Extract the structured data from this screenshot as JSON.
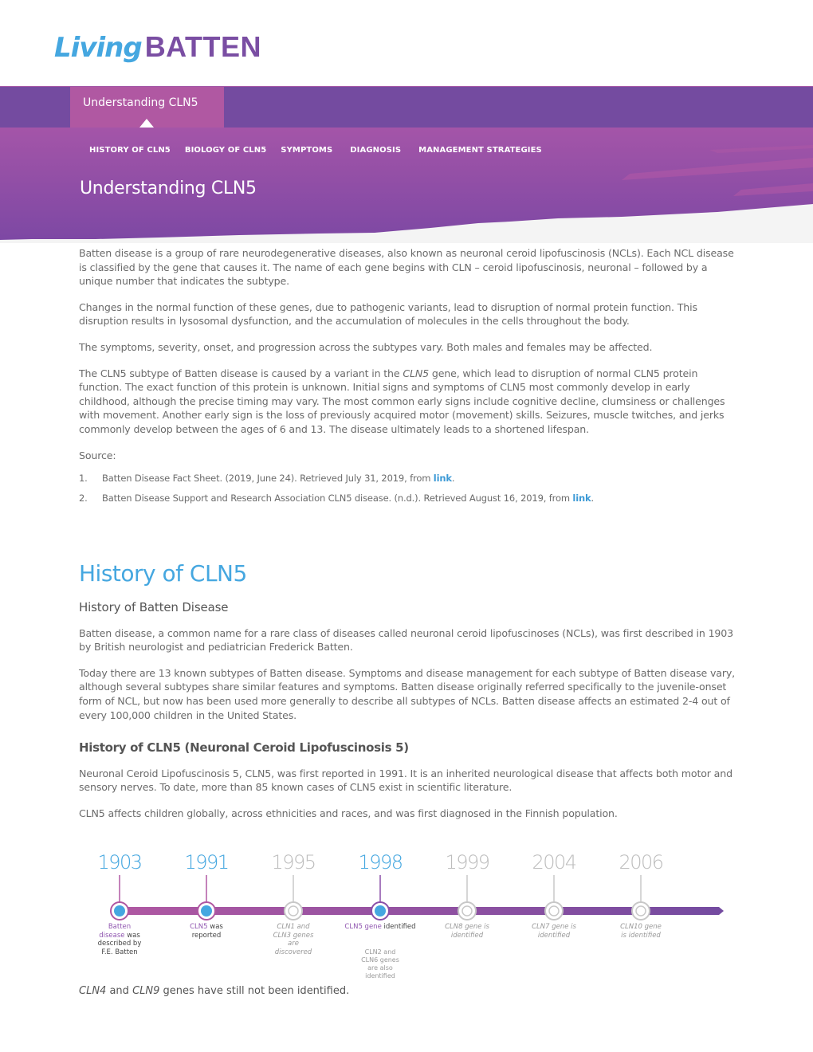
{
  "logo": {
    "part1": "Living",
    "part2": "BATTEN"
  },
  "topbar": {
    "active_tab": "Understanding CLN5"
  },
  "subnav": [
    {
      "label": "HISTORY OF CLN5"
    },
    {
      "label": "BIOLOGY OF CLN5"
    },
    {
      "label": "SYMPTOMS"
    },
    {
      "label": "DIAGNOSIS"
    },
    {
      "label": "MANAGEMENT STRATEGIES"
    }
  ],
  "hero": {
    "title": "Understanding CLN5"
  },
  "colors": {
    "purple_dark": "#744ba0",
    "pink": "#b058a2",
    "blue": "#45a7e0",
    "link": "#3d9ad6",
    "grey_bg": "#f4f4f4"
  },
  "understanding": {
    "p1": "Batten disease is a group of rare neurodegenerative diseases, also known as neuronal ceroid lipofuscinosis (NCLs). Each NCL disease is classified by the gene that causes it. The name of each gene begins with CLN – ceroid lipofuscinosis, neuronal – followed by a unique number that indicates the subtype.",
    "p2": "Changes in the normal function of these genes, due to pathogenic variants, lead to disruption of normal protein function. This disruption results in lysosomal dysfunction, and the accumulation of molecules in the cells throughout the body.",
    "p3": "The symptoms, severity, onset, and progression across the subtypes vary. Both males and females may be affected.",
    "p4_pre": "The CLN5 subtype of Batten disease is caused by a variant in the ",
    "p4_gene": "CLN5",
    "p4_post": " gene, which lead to disruption of normal CLN5 protein function. The exact function of this protein is unknown. Initial signs and symptoms of CLN5 most commonly develop in early childhood, although the precise timing may vary. The most common early signs include cognitive decline, clumsiness or challenges with movement. Another early sign is the loss of previously acquired motor (movement) skills. Seizures, muscle twitches, and jerks commonly develop between the ages of 6 and 13. The disease ultimately leads to a shortened lifespan.",
    "source_label": "Source:",
    "sources": [
      {
        "num": "1.",
        "text": "Batten Disease Fact Sheet. (2019, June 24). Retrieved July 31, 2019, from ",
        "link": "link",
        "end": "."
      },
      {
        "num": "2.",
        "text": "Batten Disease Support and Research Association CLN5 disease. (n.d.). Retrieved August 16, 2019, from ",
        "link": "link",
        "end": "."
      }
    ]
  },
  "history": {
    "title": "History of CLN5",
    "sub1": "History of Batten Disease",
    "p1": "Batten disease, a common name for a rare class of diseases called neuronal ceroid lipofuscinoses (NCLs), was first described in 1903 by British neurologist and pediatrician Frederick Batten.",
    "p2": "Today there are 13 known subtypes of Batten disease. Symptoms and disease management for each subtype of Batten disease vary, although several subtypes share similar features and symptoms. Batten disease originally referred specifically to the juvenile-onset form of NCL, but now has been used more generally to describe all subtypes of NCLs. Batten disease affects an estimated 2-4 out of every 100,000 children in the United States.",
    "sub2": "History of CLN5 (Neuronal Ceroid Lipofuscinosis 5)",
    "p3": "Neuronal Ceroid Lipofuscinosis 5, CLN5, was first reported in 1991. It is an inherited neurological disease that affects both motor and sensory nerves. To date, more than 85 known cases of CLN5 exist in scientific literature.",
    "p4": "CLN5 affects children globally, across ethnicities and races, and was first diagnosed in the Finnish population."
  },
  "timeline": [
    {
      "year": "1903",
      "active": true,
      "hl": "Batten disease",
      "rest": " was described by F.E. Batten"
    },
    {
      "year": "1991",
      "active": true,
      "hl": "CLN5",
      "rest": " was reported"
    },
    {
      "year": "1995",
      "active": false,
      "text": "CLN1 and CLN3 genes are discovered"
    },
    {
      "year": "1998",
      "active": true,
      "hl": "CLN5 gene",
      "rest": " identified",
      "extra": "CLN2 and CLN6 genes are also identified"
    },
    {
      "year": "1999",
      "active": false,
      "text": "CLN8 gene is identified"
    },
    {
      "year": "2004",
      "active": false,
      "text": "CLN7 gene is identified"
    },
    {
      "year": "2006",
      "active": false,
      "text": "CLN10 gene is identified"
    }
  ],
  "footer_note": {
    "gene1": "CLN4",
    "mid": " and ",
    "gene2": "CLN9",
    "rest": " genes have still not been identified."
  }
}
